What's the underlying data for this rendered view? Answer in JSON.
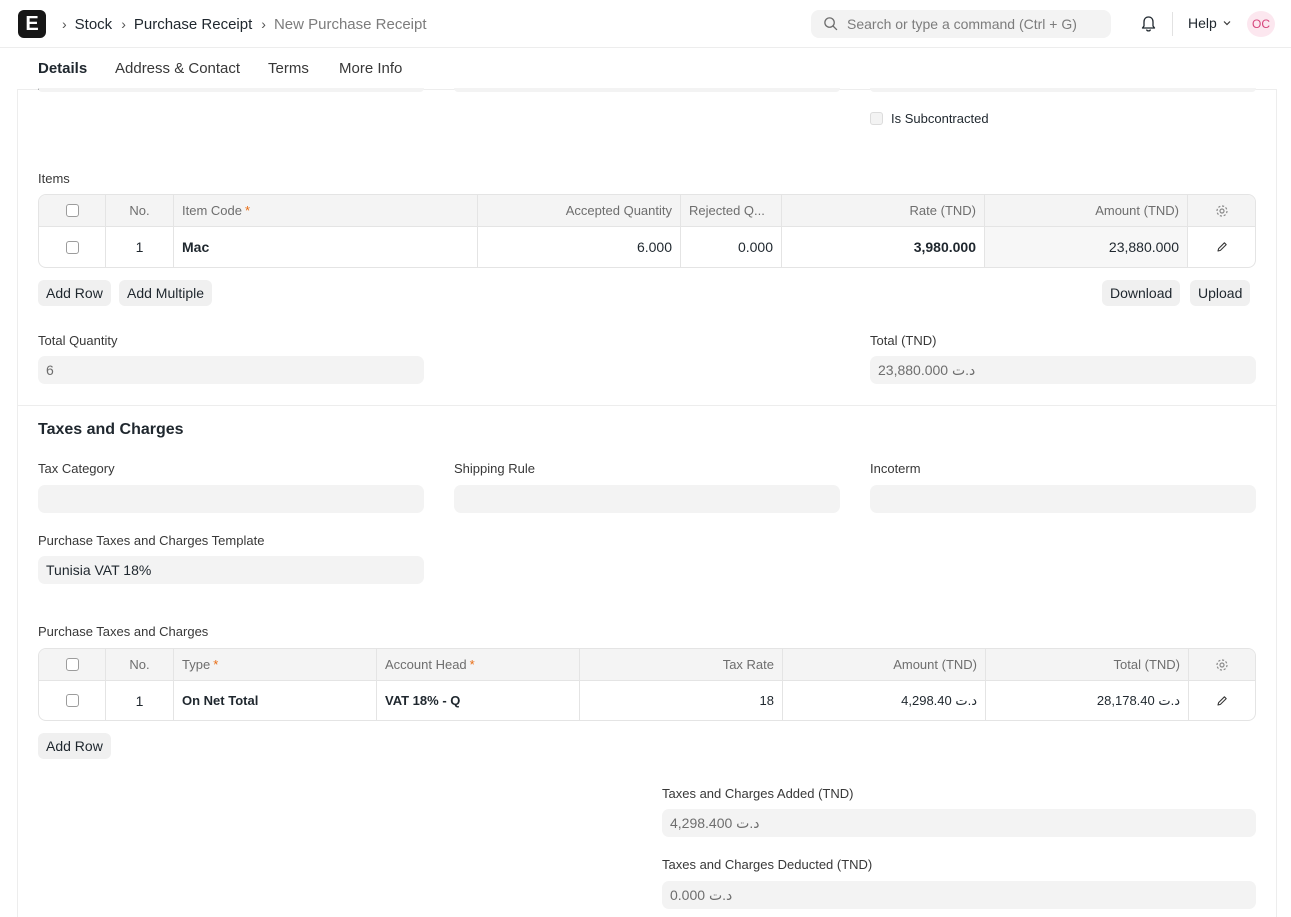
{
  "navbar": {
    "logo_letter": "E",
    "breadcrumbs": [
      "Stock",
      "Purchase Receipt",
      "New Purchase Receipt"
    ],
    "search_placeholder": "Search or type a command (Ctrl + G)",
    "help_label": "Help",
    "avatar_initials": "OC"
  },
  "tabs": [
    "Details",
    "Address & Contact",
    "Terms",
    "More Info"
  ],
  "is_subcontracted_label": "Is Subcontracted",
  "items": {
    "label": "Items",
    "columns": [
      "No.",
      "Item Code",
      "Accepted Quantity",
      "Rejected Q...",
      "Rate (TND)",
      "Amount (TND)"
    ],
    "rows": [
      {
        "no": "1",
        "item_code": "Mac",
        "accepted_qty": "6.000",
        "rejected_qty": "0.000",
        "rate": "3,980.000",
        "amount": "23,880.000"
      }
    ],
    "buttons": {
      "add_row": "Add Row",
      "add_multiple": "Add Multiple",
      "download": "Download",
      "upload": "Upload"
    }
  },
  "totals": {
    "total_quantity_label": "Total Quantity",
    "total_quantity": "6",
    "total_label": "Total (TND)",
    "total": "23,880.000 د.ت"
  },
  "taxes": {
    "title": "Taxes and Charges",
    "tax_category_label": "Tax Category",
    "shipping_rule_label": "Shipping Rule",
    "incoterm_label": "Incoterm",
    "template_label": "Purchase Taxes and Charges Template",
    "template_value": "Tunisia VAT 18%",
    "table_label": "Purchase Taxes and Charges",
    "columns": [
      "No.",
      "Type",
      "Account Head",
      "Tax Rate",
      "Amount (TND)",
      "Total (TND)"
    ],
    "rows": [
      {
        "no": "1",
        "type": "On Net Total",
        "account_head": "VAT 18% - Q",
        "tax_rate": "18",
        "amount": "4,298.40 د.ت",
        "total": "28,178.40 د.ت"
      }
    ],
    "add_row": "Add Row",
    "added_label": "Taxes and Charges Added (TND)",
    "added_value": "4,298.400 د.ت",
    "deducted_label": "Taxes and Charges Deducted (TND)",
    "deducted_value": "0.000 د.ت"
  }
}
